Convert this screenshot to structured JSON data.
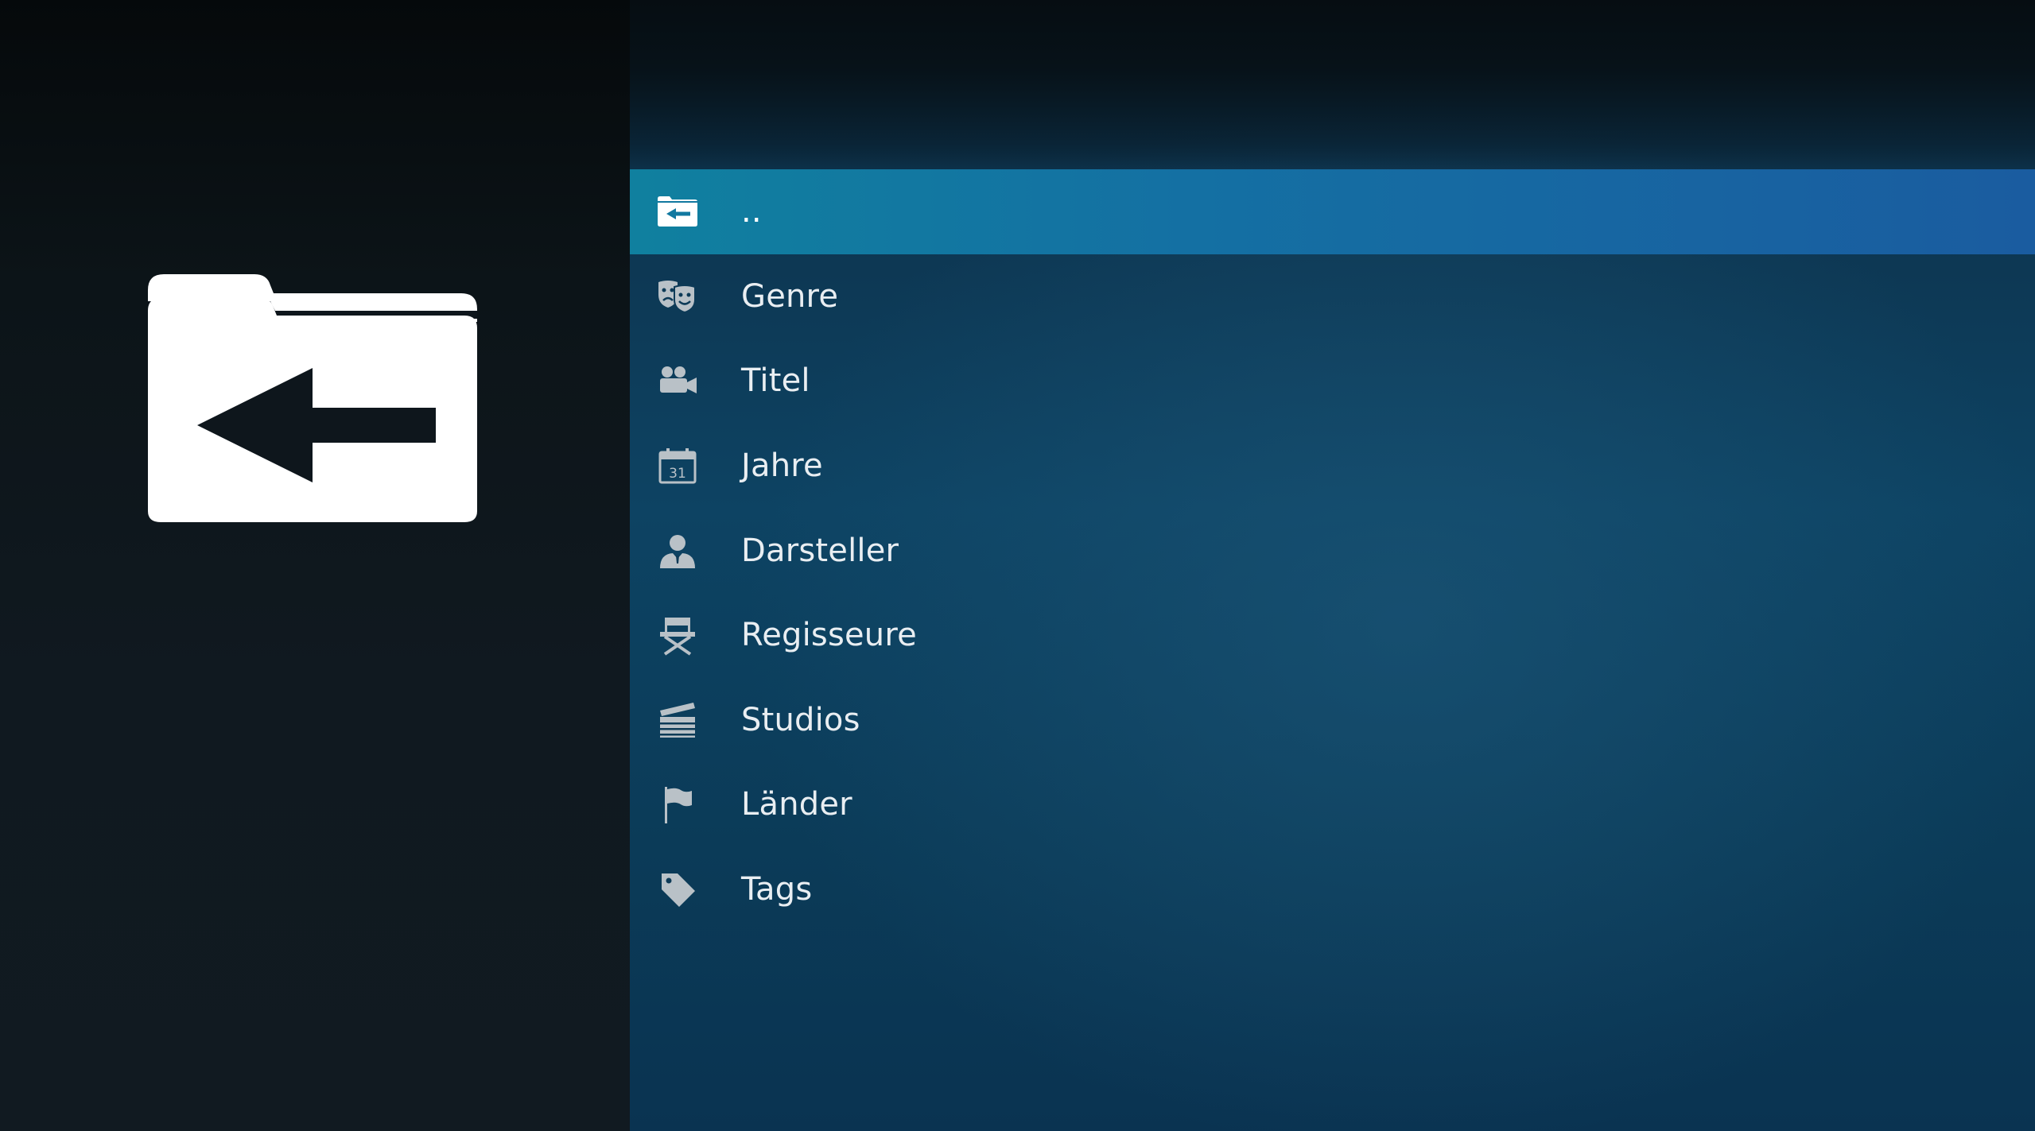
{
  "preview": {
    "icon": "folder-back-icon"
  },
  "list": {
    "items": [
      {
        "label": "..",
        "icon": "folder-back-icon",
        "focused": true
      },
      {
        "label": "Genre",
        "icon": "theater-masks-icon"
      },
      {
        "label": "Titel",
        "icon": "movie-camera-icon"
      },
      {
        "label": "Jahre",
        "icon": "calendar-icon",
        "icon_text": "31"
      },
      {
        "label": "Darsteller",
        "icon": "actor-person-icon"
      },
      {
        "label": "Regisseure",
        "icon": "director-chair-icon"
      },
      {
        "label": "Studios",
        "icon": "clapperboard-icon"
      },
      {
        "label": "Länder",
        "icon": "flag-icon"
      },
      {
        "label": "Tags",
        "icon": "tag-icon"
      }
    ]
  },
  "colors": {
    "focus_start": "#10809f",
    "focus_end": "#1a5ca0",
    "icon_gray": "#b9c1c7",
    "text": "#e9eef2"
  }
}
